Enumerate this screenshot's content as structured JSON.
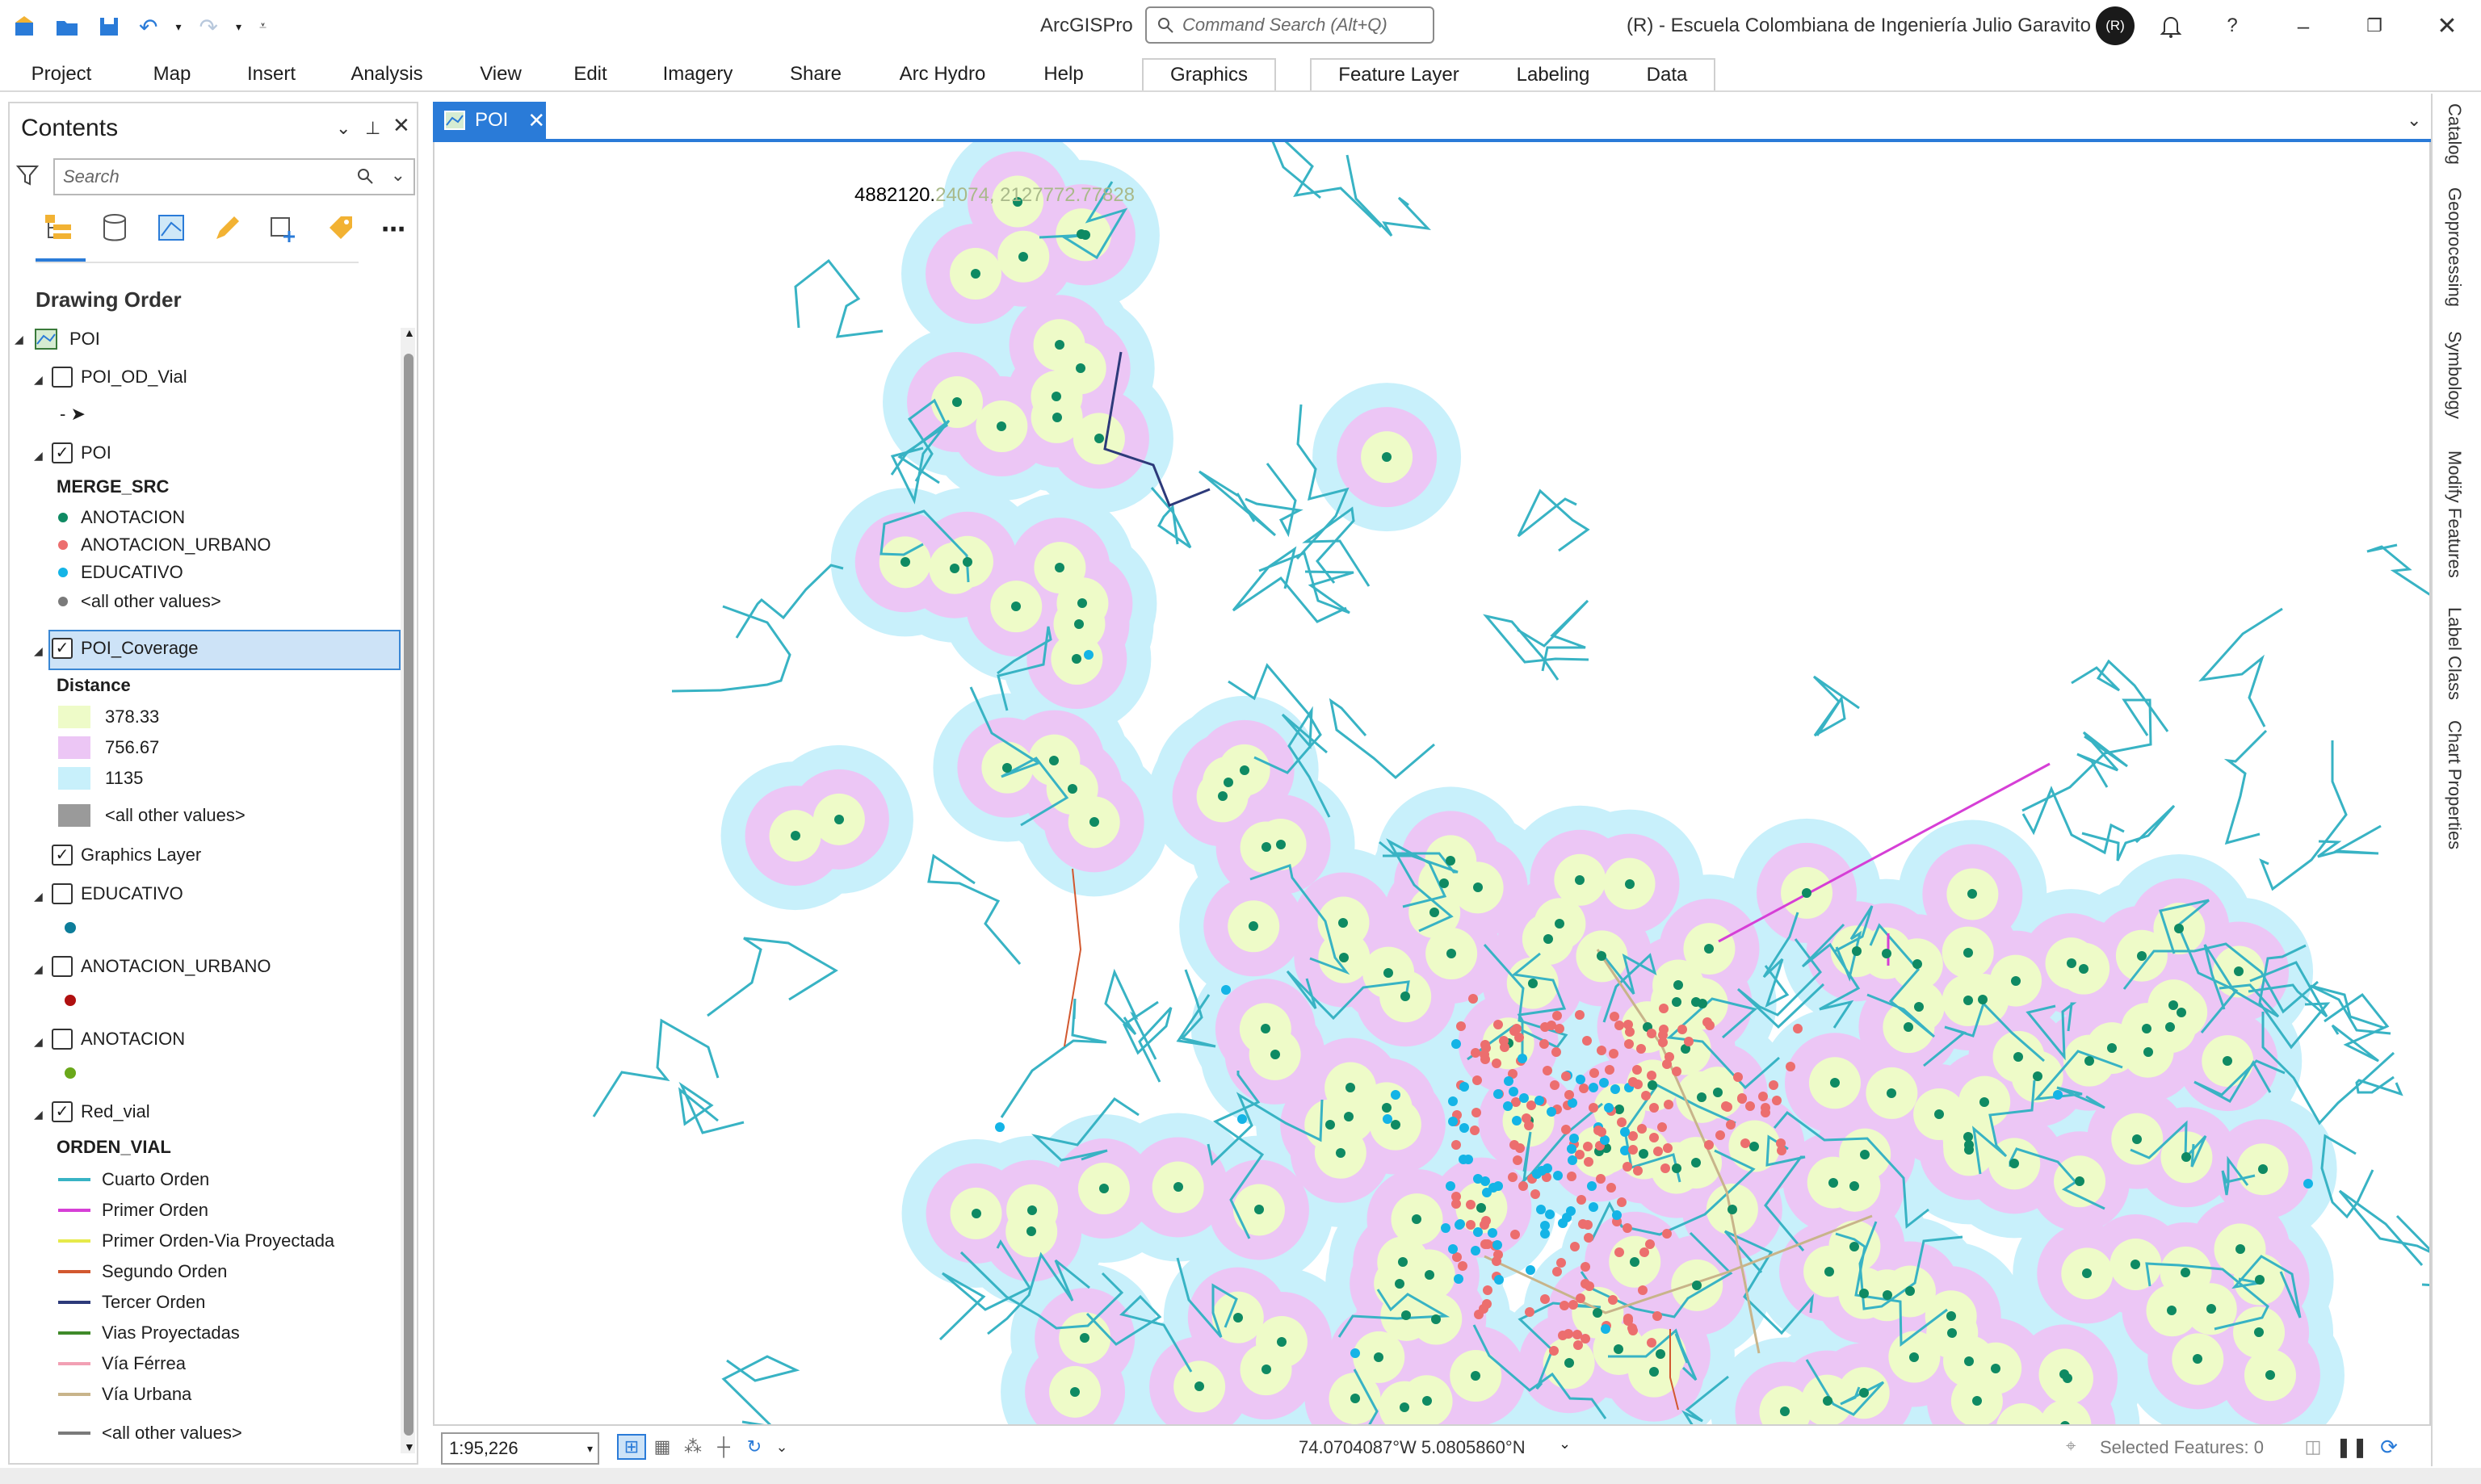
{
  "titlebar": {
    "app_name": "ArcGISPro",
    "search_placeholder": "Command Search (Alt+Q)",
    "org": "(R) - Escuela Colombiana de Ingeniería Julio Garavito",
    "avatar_initials": "(R)"
  },
  "ribbon": {
    "tabs": [
      "Project",
      "Map",
      "Insert",
      "Analysis",
      "View",
      "Edit",
      "Imagery",
      "Share",
      "Arc Hydro",
      "Help"
    ],
    "contextual_tabs": [
      "Graphics",
      "Feature Layer",
      "Labeling",
      "Data"
    ]
  },
  "contents": {
    "title": "Contents",
    "search_placeholder": "Search",
    "section": "Drawing Order",
    "map_name": "POI",
    "layers": {
      "poi_od_vial": "POI_OD_Vial",
      "poi": "POI",
      "poi_field": "MERGE_SRC",
      "poi_classes": [
        {
          "label": "ANOTACION",
          "color": "#0f8a63"
        },
        {
          "label": "ANOTACION_URBANO",
          "color": "#ec6e6e"
        },
        {
          "label": "EDUCATIVO",
          "color": "#14b4e6"
        },
        {
          "label": "<all other values>",
          "color": "#7a7a7a"
        }
      ],
      "coverage": "POI_Coverage",
      "coverage_field": "Distance",
      "coverage_classes": [
        {
          "label": "378.33",
          "color": "#eefbc8"
        },
        {
          "label": "756.67",
          "color": "#ecc6f5"
        },
        {
          "label": "1135",
          "color": "#c8f0fb"
        },
        {
          "label": "<all other values>",
          "color": "#9a9a9a"
        }
      ],
      "graphics": "Graphics Layer",
      "educativo": "EDUCATIVO",
      "anotacion_urbano": "ANOTACION_URBANO",
      "anotacion": "ANOTACION",
      "red_vial": "Red_vial",
      "red_vial_field": "ORDEN_VIAL",
      "red_vial_classes": [
        {
          "label": "Cuarto Orden",
          "color": "#38b3c4"
        },
        {
          "label": "Primer Orden",
          "color": "#d63fd6"
        },
        {
          "label": "Primer Orden-Via Proyectada",
          "color": "#e6ea4a"
        },
        {
          "label": "Segundo Orden",
          "color": "#d2582f"
        },
        {
          "label": "Tercer Orden",
          "color": "#2d3a7a"
        },
        {
          "label": "Vias Proyectadas",
          "color": "#3f8a2a"
        },
        {
          "label": "Vía Férrea",
          "color": "#f2a0b4"
        },
        {
          "label": "Vía Urbana",
          "color": "#c8b48a"
        },
        {
          "label": "<all other values>",
          "color": "#7a7a7a"
        }
      ]
    }
  },
  "map": {
    "tab_label": "POI",
    "coordinate_label_main": "4882120.",
    "coordinate_label_faded": "24074, 2127772.77828"
  },
  "status": {
    "scale": "1:95,226",
    "coordinates": "74.0704087°W 5.0805860°N",
    "selected": "Selected Features: 0"
  },
  "right_dock": [
    "Catalog",
    "Geoprocessing",
    "Symbology",
    "Modify Features",
    "Label Class",
    "Chart Properties"
  ]
}
